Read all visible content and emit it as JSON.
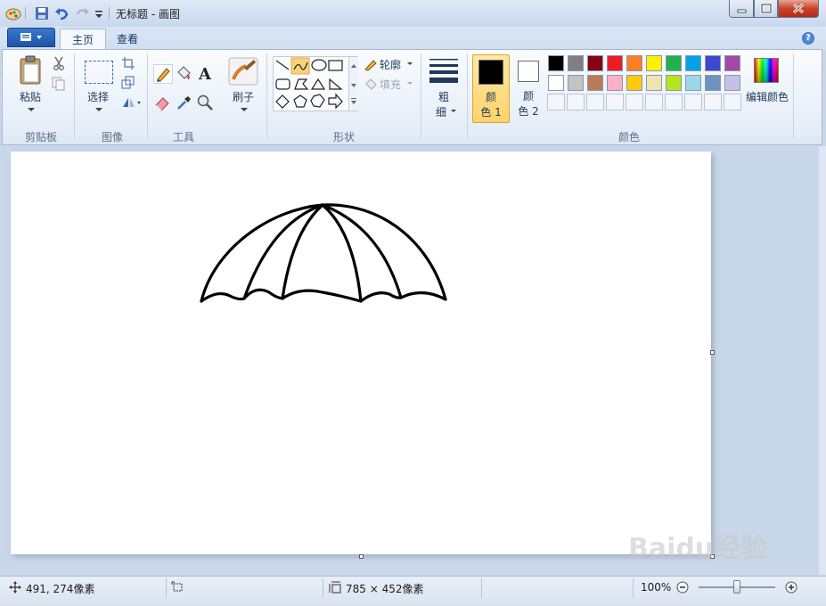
{
  "window": {
    "title": "无标题 - 画图"
  },
  "tabs": [
    {
      "label": "主页"
    },
    {
      "label": "查看"
    }
  ],
  "ribbon": {
    "clipboard": {
      "paste": "粘贴",
      "group": "剪贴板"
    },
    "image": {
      "select": "选择",
      "group": "图像"
    },
    "tools": {
      "group": "工具"
    },
    "brushes": {
      "label": "刷子"
    },
    "shapes": {
      "outline": "轮廓",
      "fill": "填充",
      "group": "形状"
    },
    "size": {
      "label_top": "粗",
      "label_bottom": "细"
    },
    "colors": {
      "color1_top": "颜",
      "color1_bottom": "色 1",
      "color2_top": "颜",
      "color2_bottom": "色 2",
      "edit": "编辑颜色",
      "group": "颜色",
      "color1_value": "#000000",
      "color2_value": "#ffffff",
      "palette_row1": [
        "#000000",
        "#7f7f7f",
        "#880015",
        "#ed1c24",
        "#ff7f27",
        "#fff200",
        "#22b14c",
        "#00a2e8",
        "#3f48cc",
        "#a349a4"
      ],
      "palette_row2": [
        "#ffffff",
        "#c3c3c3",
        "#b97a57",
        "#ffaec9",
        "#ffc90e",
        "#efe4b0",
        "#b5e61d",
        "#99d9ea",
        "#7092be",
        "#c8bfe7"
      ]
    }
  },
  "status": {
    "position": "491, 274像素",
    "canvas_size": "785 × 452像素",
    "zoom": "100%",
    "zoom_level": 1.0
  },
  "watermark": "Baidu经验"
}
